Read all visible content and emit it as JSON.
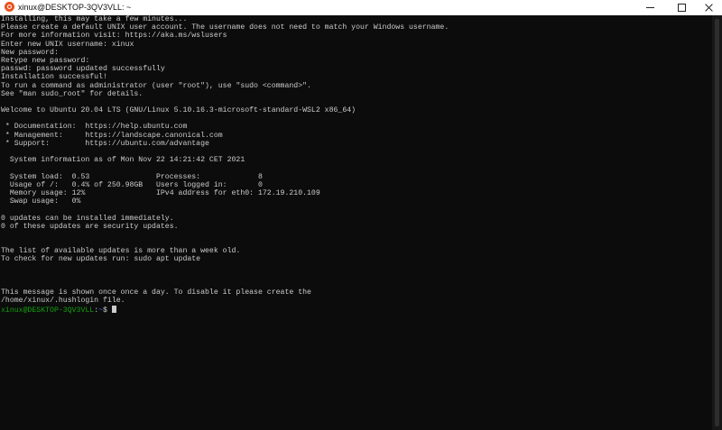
{
  "window": {
    "title": "xinux@DESKTOP-3QV3VLL: ~",
    "app_icon": "ubuntu-icon",
    "controls": [
      "minimize-icon",
      "maximize-icon",
      "close-icon"
    ]
  },
  "terminal": {
    "lines": [
      "Installing, this may take a few minutes...",
      "Please create a default UNIX user account. The username does not need to match your Windows username.",
      "For more information visit: https://aka.ms/wslusers",
      "Enter new UNIX username: xinux",
      "New password:",
      "Retype new password:",
      "passwd: password updated successfully",
      "Installation successful!",
      "To run a command as administrator (user \"root\"), use \"sudo <command>\".",
      "See \"man sudo_root\" for details.",
      "",
      "Welcome to Ubuntu 20.04 LTS (GNU/Linux 5.10.16.3-microsoft-standard-WSL2 x86_64)",
      "",
      " * Documentation:  https://help.ubuntu.com",
      " * Management:     https://landscape.canonical.com",
      " * Support:        https://ubuntu.com/advantage",
      "",
      "  System information as of Mon Nov 22 14:21:42 CET 2021",
      "",
      "  System load:  0.53               Processes:             8",
      "  Usage of /:   0.4% of 250.98GB   Users logged in:       0",
      "  Memory usage: 12%                IPv4 address for eth0: 172.19.210.109",
      "  Swap usage:   0%",
      "",
      "0 updates can be installed immediately.",
      "0 of these updates are security updates.",
      "",
      "",
      "The list of available updates is more than a week old.",
      "To check for new updates run: sudo apt update",
      "",
      "",
      "",
      "This message is shown once once a day. To disable it please create the",
      "/home/xinux/.hushlogin file."
    ],
    "prompt": {
      "user_host": "xinux@DESKTOP-3QV3VLL",
      "separator": ":",
      "path": "~",
      "symbol": "$ "
    }
  },
  "colors": {
    "background": "#0c0c0c",
    "text": "#cccccc",
    "prompt_user": "#13a10e",
    "prompt_path": "#3b78ff",
    "titlebar": "#ffffff"
  }
}
